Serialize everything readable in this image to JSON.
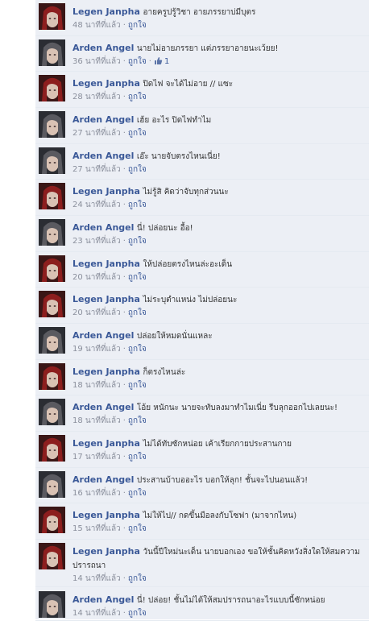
{
  "comments": [
    {
      "author": "Legen Janpha",
      "avatar": "red-hair",
      "text": "อายครูปรู้วิชา อายภรรยาบ่มีบุตร",
      "time": "48 นาทีที่แล้ว",
      "like": "ถูกใจ"
    },
    {
      "author": "Arden Angel",
      "avatar": "gray-hair",
      "text": "นายไม่อายภรรยา แต่ภรรยาอายนะเว้ยย!",
      "time": "36 นาทีที่แล้ว",
      "like": "ถูกใจ",
      "likes": "1"
    },
    {
      "author": "Legen Janpha",
      "avatar": "red-hair",
      "text": "ปิดไฟ จะได้ไม่อาย // แซะ",
      "time": "28 นาทีที่แล้ว",
      "like": "ถูกใจ"
    },
    {
      "author": "Arden Angel",
      "avatar": "gray-hair",
      "text": "เฮ้ย อะไร ปิดไฟทำไม",
      "time": "27 นาทีที่แล้ว",
      "like": "ถูกใจ"
    },
    {
      "author": "Arden Angel",
      "avatar": "gray-hair",
      "text": "เอ๊ะ นายจับตรงไหนเนี่ย!",
      "time": "27 นาทีที่แล้ว",
      "like": "ถูกใจ"
    },
    {
      "author": "Legen Janpha",
      "avatar": "red-hair",
      "text": "ไม่รู้สิ คิดว่าจับทุกส่วนนะ",
      "time": "24 นาทีที่แล้ว",
      "like": "ถูกใจ"
    },
    {
      "author": "Arden Angel",
      "avatar": "gray-hair",
      "text": "นี่! ปล่อยนะ อื้อ!",
      "time": "23 นาทีที่แล้ว",
      "like": "ถูกใจ"
    },
    {
      "author": "Legen Janpha",
      "avatar": "red-hair",
      "text": "ให้ปล่อยตรงไหนล่ะอะเด็น",
      "time": "20 นาทีที่แล้ว",
      "like": "ถูกใจ"
    },
    {
      "author": "Legen Janpha",
      "avatar": "red-hair",
      "text": "ไม่ระบุตำแหน่ง ไม่ปล่อยนะ",
      "time": "20 นาทีที่แล้ว",
      "like": "ถูกใจ"
    },
    {
      "author": "Arden Angel",
      "avatar": "gray-hair",
      "text": "ปล่อยให้หมดนั่นแหละ",
      "time": "19 นาทีที่แล้ว",
      "like": "ถูกใจ"
    },
    {
      "author": "Legen Janpha",
      "avatar": "red-hair",
      "text": "ก็ตรงไหนล่ะ",
      "time": "18 นาทีที่แล้ว",
      "like": "ถูกใจ"
    },
    {
      "author": "Arden Angel",
      "avatar": "gray-hair",
      "text": "โอ้ย หนักนะ นายจะทับลงมาทำไมเนี่ย รีบลุกออกไปเลยนะ!",
      "time": "18 นาทีที่แล้ว",
      "like": "ถูกใจ"
    },
    {
      "author": "Legen Janpha",
      "avatar": "red-hair",
      "text": "ไม่ได้ทับซักหน่อย เค้าเรียกกายประสานกาย",
      "time": "17 นาทีที่แล้ว",
      "like": "ถูกใจ"
    },
    {
      "author": "Arden Angel",
      "avatar": "gray-hair",
      "text": "ประสานบ้าบออะไร บอกให้ลุก! ชั้นจะไปนอนแล้ว!",
      "time": "16 นาทีที่แล้ว",
      "like": "ถูกใจ"
    },
    {
      "author": "Legen Janpha",
      "avatar": "red-hair",
      "text": "ไม่ให้ไป// กดขึ้นมือลงกับโซฟา (มาจากไหน)",
      "time": "15 นาทีที่แล้ว",
      "like": "ถูกใจ"
    },
    {
      "author": "Legen Janpha",
      "avatar": "red-hair",
      "text": "วันนี้ปีใหม่นะเด็น นายบอกเอง ขอให้ชั้นคิดหวังสิ่งใดให้สมความปรารถนา",
      "time": "14 นาทีที่แล้ว",
      "like": "ถูกใจ"
    },
    {
      "author": "Arden Angel",
      "avatar": "gray-hair",
      "text": "นี่! ปล่อย! ชั้นไม่ได้ให้สมปรารถนาอะไรแบบนี้ซักหน่อย",
      "time": "14 นาทีที่แล้ว",
      "like": "ถูกใจ"
    }
  ],
  "meta_separator": "·",
  "colors": {
    "author": "#3b5998",
    "thread_bg": "#eceff5",
    "meta": "#8a8f9c"
  }
}
